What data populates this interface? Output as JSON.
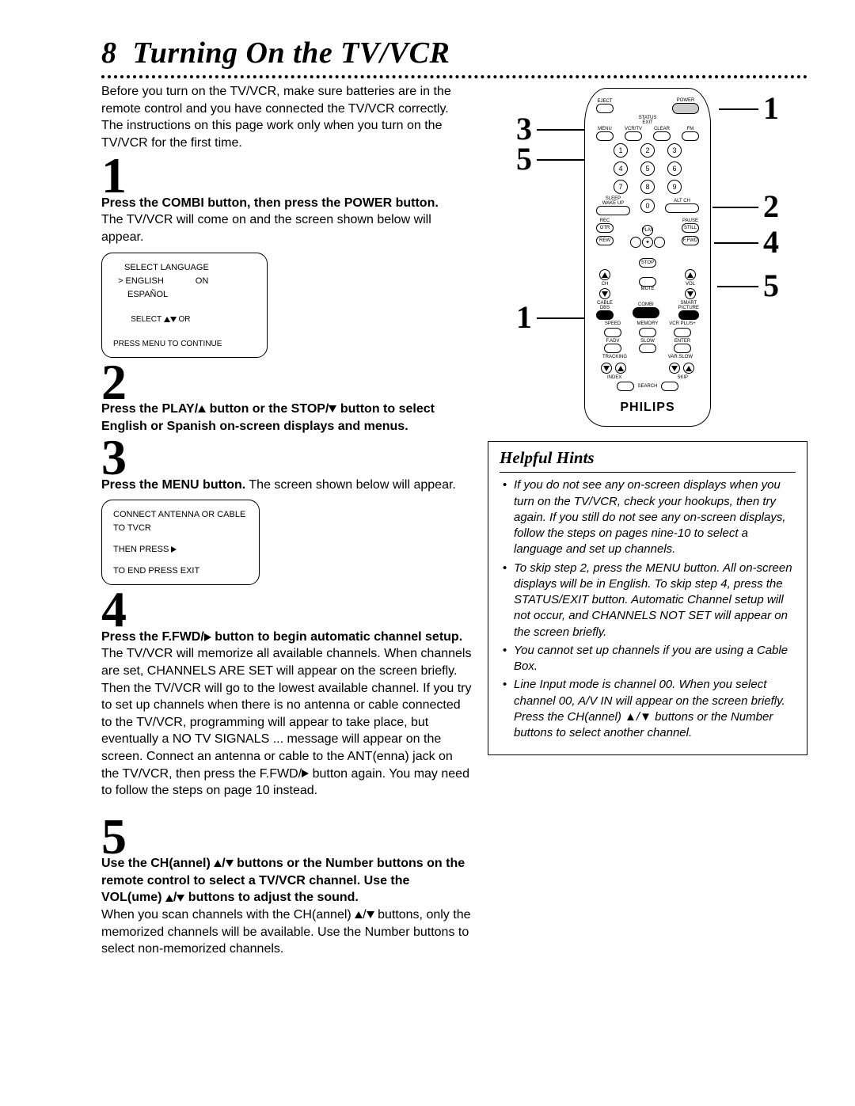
{
  "page": {
    "number": "8",
    "title": "Turning On the TV/VCR"
  },
  "intro": "Before you turn on the TV/VCR, make sure batteries are in the remote control and you have connected the TV/VCR correctly. The instructions on this page work only when you turn on the TV/VCR for the first time.",
  "steps": {
    "s1": {
      "num": "1",
      "bold": "Press the COMBI button, then press the POWER button.",
      "text": "The TV/VCR will come on and the screen shown below will appear."
    },
    "s2": {
      "num": "2",
      "bold_a": "Press the PLAY/",
      "bold_b": " button or the STOP/",
      "bold_c": " button to select English or Spanish on-screen displays and menus."
    },
    "s3": {
      "num": "3",
      "bold": "Press the MENU button.",
      "text": " The screen shown below will appear."
    },
    "s4": {
      "num": "4",
      "bold_a": "Press the F.FWD/",
      "bold_b": " button to begin automatic channel setup.",
      "text_a": " The TV/VCR will memorize all available channels. When channels are set, CHANNELS ARE SET will appear on the screen briefly. Then the TV/VCR will go to the lowest available channel. If you try to set up channels when there is no antenna or cable connected to the TV/VCR, programming will appear to take place, but eventually a NO TV SIGNALS ... message will appear on the screen. Connect an antenna or cable to the ANT(enna) jack on the TV/VCR, then press the F.FWD/",
      "text_b": " button again. You may need to follow the steps on page 10 instead."
    },
    "s5": {
      "num": "5",
      "bold_a": "Use the CH(annel) ",
      "bold_b": " buttons or the Number buttons on the remote control to select a TV/VCR channel. Use the VOL(ume) ",
      "bold_c": " buttons to adjust the sound.",
      "text_a": "When you scan channels with the CH(annel) ",
      "text_b": " buttons, only the memorized channels will be available. Use the Number buttons to select non-memorized channels."
    }
  },
  "screen1": {
    "l1": "SELECT LANGUAGE",
    "l2a": "> ENGLISH",
    "l2b": "ON",
    "l3": "ESPAÑOL",
    "l4a": "SELECT ",
    "l4b": " OR",
    "l5": "PRESS MENU TO CONTINUE"
  },
  "screen2": {
    "l1": "CONNECT ANTENNA OR CABLE",
    "l2": "TO TVCR",
    "l3": "THEN PRESS ",
    "l4": "TO END PRESS EXIT"
  },
  "remote": {
    "brand": "PHILIPS",
    "labels": {
      "eject": "EJECT",
      "power": "POWER",
      "status": "STATUS",
      "exit": "EXIT",
      "menu": "MENU",
      "vcrtv": "VCR/TV",
      "clear": "CLEAR",
      "fm": "FM",
      "sleep": "SLEEP",
      "altch": "ALT CH",
      "wakeup": "WAKE UP",
      "rec": "REC",
      "otr": "OTR",
      "pause": "PAUSE",
      "still": "STILL",
      "play": "PLAY",
      "rew": "REW",
      "ffwd": "F.FWD",
      "stop": "STOP",
      "ch": "CH",
      "vol": "VOL",
      "mute": "MUTE",
      "cable": "CABLE",
      "dbs": "DBS",
      "combi": "COMBI",
      "smart": "SMART",
      "picture": "PICTURE",
      "speed": "SPEED",
      "memory": "MEMORY",
      "vcrplus": "VCR PLUS+",
      "fadv": "F.ADV",
      "slow": "SLOW",
      "enter": "ENTER",
      "tracking": "TRACKING",
      "varslow": "VAR.SLOW",
      "index": "INDEX",
      "skip": "SKIP",
      "search": "SEARCH"
    },
    "nums": [
      "1",
      "2",
      "3",
      "4",
      "5",
      "6",
      "7",
      "8",
      "9",
      "0"
    ]
  },
  "callouts": {
    "r1": "1",
    "r2": "2",
    "r4": "4",
    "r5": "5",
    "l3": "3",
    "l5": "5",
    "l1": "1"
  },
  "hints": {
    "title": "Helpful Hints",
    "items": [
      "If you do not see any on-screen displays when you turn on the TV/VCR, check your hookups, then try again. If you still do not see any on-screen displays, follow the steps on pages nine-10 to select a language and set up channels.",
      "To skip step 2, press the MENU button. All on-screen displays will be in English. To skip step 4, press the STATUS/EXIT button. Automatic Channel setup will not occur, and CHANNELS NOT SET will appear on the screen briefly.",
      "You cannot set up channels if you are using a Cable Box.",
      "Line Input mode is channel 00. When you select channel 00, A/V IN will appear on the screen briefly. Press the CH(annel) ▲/▼ buttons or the Number buttons to select another channel."
    ]
  }
}
